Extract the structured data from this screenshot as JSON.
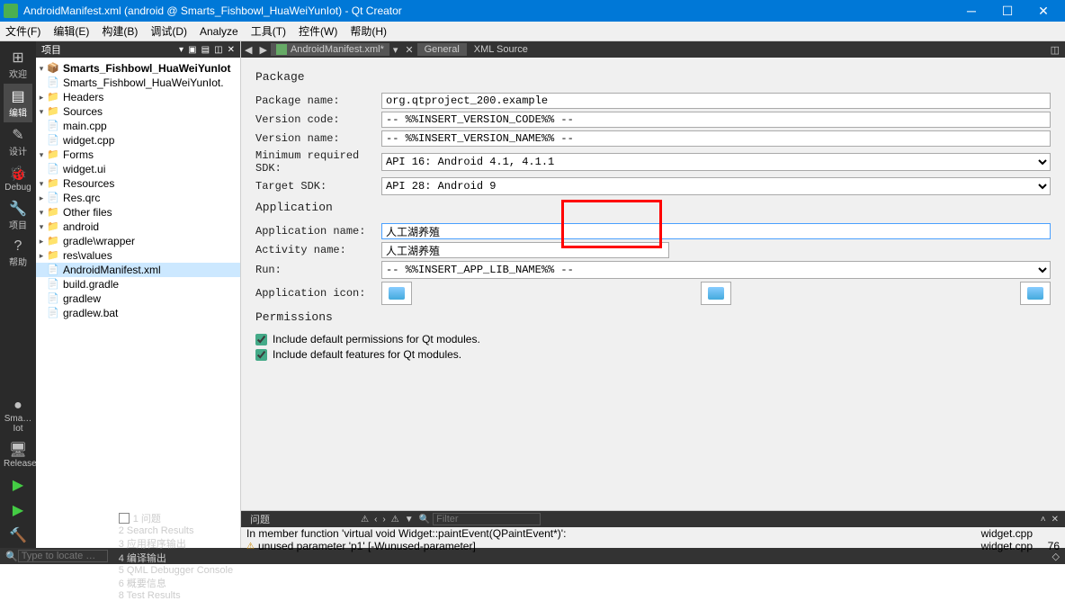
{
  "title": "AndroidManifest.xml (android @ Smarts_Fishbowl_HuaWeiYunIot) - Qt Creator",
  "menus": [
    "文件(F)",
    "编辑(E)",
    "构建(B)",
    "调试(D)",
    "Analyze",
    "工具(T)",
    "控件(W)",
    "帮助(H)"
  ],
  "sidebar": [
    {
      "g": "⊞",
      "t": "欢迎"
    },
    {
      "g": "▤",
      "t": "编辑"
    },
    {
      "g": "✎",
      "t": "设计"
    },
    {
      "g": "🐞",
      "t": "Debug"
    },
    {
      "g": "🔧",
      "t": "项目"
    },
    {
      "g": "?",
      "t": "帮助"
    }
  ],
  "sidebar_bottom": [
    {
      "g": "●",
      "t": "Sma…Iot"
    },
    {
      "g": "🖥",
      "t": "Release"
    },
    {
      "g": "▶",
      "t": ""
    },
    {
      "g": "▶",
      "t": ""
    },
    {
      "g": "🔨",
      "t": ""
    }
  ],
  "tree_header": "项目",
  "tree": [
    {
      "d": 0,
      "tw": "▾",
      "i": "📦",
      "t": "Smarts_Fishbowl_HuaWeiYunIot",
      "b": 1
    },
    {
      "d": 1,
      "tw": "",
      "i": "📄",
      "t": "Smarts_Fishbowl_HuaWeiYunIot."
    },
    {
      "d": 1,
      "tw": "▸",
      "i": "📁",
      "t": "Headers"
    },
    {
      "d": 1,
      "tw": "▾",
      "i": "📁",
      "t": "Sources"
    },
    {
      "d": 2,
      "tw": "",
      "i": "📄",
      "t": "main.cpp"
    },
    {
      "d": 2,
      "tw": "",
      "i": "📄",
      "t": "widget.cpp"
    },
    {
      "d": 1,
      "tw": "▾",
      "i": "📁",
      "t": "Forms"
    },
    {
      "d": 2,
      "tw": "",
      "i": "📄",
      "t": "widget.ui"
    },
    {
      "d": 1,
      "tw": "▾",
      "i": "📁",
      "t": "Resources"
    },
    {
      "d": 2,
      "tw": "▸",
      "i": "📄",
      "t": "Res.qrc"
    },
    {
      "d": 1,
      "tw": "▾",
      "i": "📁",
      "t": "Other files"
    },
    {
      "d": 2,
      "tw": "▾",
      "i": "📁",
      "t": "android"
    },
    {
      "d": 3,
      "tw": "▸",
      "i": "📁",
      "t": "gradle\\wrapper"
    },
    {
      "d": 3,
      "tw": "▸",
      "i": "📁",
      "t": "res\\values"
    },
    {
      "d": 3,
      "tw": "",
      "i": "📄",
      "t": "AndroidManifest.xml",
      "sel": 1
    },
    {
      "d": 3,
      "tw": "",
      "i": "📄",
      "t": "build.gradle"
    },
    {
      "d": 3,
      "tw": "",
      "i": "📄",
      "t": "gradlew"
    },
    {
      "d": 3,
      "tw": "",
      "i": "📄",
      "t": "gradlew.bat"
    }
  ],
  "tab": {
    "file": "AndroidManifest.xml*",
    "mode_general": "General",
    "mode_xml": "XML Source"
  },
  "pkg": {
    "section": "Package",
    "name_l": "Package name:",
    "name_v": "org.qtproject_200.example",
    "vcode_l": "Version code:",
    "vcode_v": "-- %%INSERT_VERSION_CODE%% --",
    "vname_l": "Version name:",
    "vname_v": "-- %%INSERT_VERSION_NAME%% --",
    "minsdk_l": "Minimum required SDK:",
    "minsdk_v": "API 16: Android 4.1, 4.1.1",
    "tgtsdk_l": "Target SDK:",
    "tgtsdk_v": "API 28: Android 9"
  },
  "app": {
    "section": "Application",
    "appname_l": "Application name:",
    "appname_v": "人工湖养殖",
    "actname_l": "Activity name:",
    "actname_v": "人工湖养殖",
    "run_l": "Run:",
    "run_v": "-- %%INSERT_APP_LIB_NAME%% --",
    "icon_l": "Application icon:"
  },
  "perm": {
    "section": "Permissions",
    "chk1": "Include default permissions for Qt modules.",
    "chk2": "Include default features for Qt modules."
  },
  "issues": {
    "title": "问题",
    "filter_ph": "Filter",
    "r1": {
      "msg": "In member function 'virtual void Widget::paintEvent(QPaintEvent*)':",
      "file": "widget.cpp",
      "ln": ""
    },
    "r2": {
      "msg": "unused parameter 'p1' [-Wunused-parameter]",
      "file": "widget.cpp",
      "ln": "76"
    }
  },
  "bottom": {
    "locate_ph": "Type to locate …",
    "items": [
      "1 问题",
      "2 Search Results",
      "3 应用程序输出",
      "4 编译输出",
      "5 QML Debugger Console",
      "6 概要信息",
      "8 Test Results"
    ]
  }
}
